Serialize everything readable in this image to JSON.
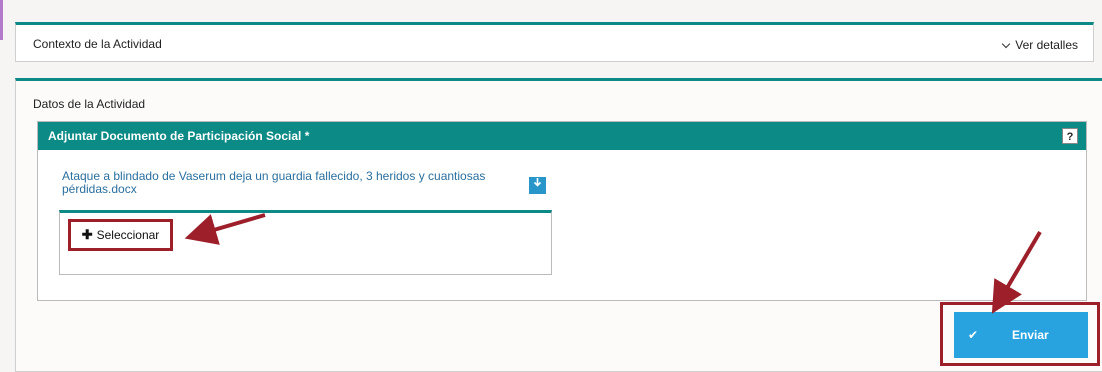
{
  "context_panel": {
    "title": "Contexto de la Actividad",
    "toggle_label": "Ver detalles"
  },
  "datos_panel": {
    "title": "Datos de la Actividad",
    "attachment": {
      "header": "Adjuntar Documento de Participación Social *",
      "help_label": "?",
      "file_name": "Ataque a blindado de Vaserum deja un guardia fallecido, 3 heridos y cuantiosas pérdidas.docx",
      "download_icon": "download-arrow-icon",
      "select_label": "Seleccionar",
      "select_icon": "plus-icon"
    }
  },
  "actions": {
    "submit_label": "Enviar",
    "submit_icon": "check-icon"
  },
  "colors": {
    "teal": "#0b8a86",
    "submit_blue": "#29a3e0",
    "annotation_red": "#9c1f29",
    "file_link": "#2a6f9e"
  }
}
